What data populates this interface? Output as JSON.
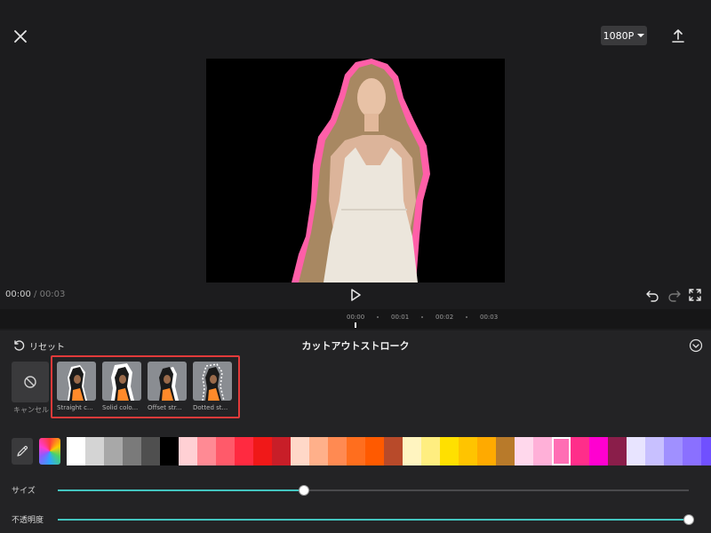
{
  "header": {
    "resolution_label": "1080P"
  },
  "playback": {
    "current_time": "00:00",
    "separator": "/",
    "duration": "00:03"
  },
  "timeline": {
    "ticks": [
      "00:00",
      "00:01",
      "00:02",
      "00:03"
    ]
  },
  "panel": {
    "reset_label": "リセット",
    "title": "カットアウトストローク",
    "cancel_label": "キャンセル",
    "presets": [
      {
        "label": "Straight c..."
      },
      {
        "label": "Solid colo..."
      },
      {
        "label": "Offset str..."
      },
      {
        "label": "Dotted st..."
      }
    ],
    "swatches": [
      "#ffffff",
      "#d4d4d4",
      "#a8a8a8",
      "#7a7a7a",
      "#4f4f4f",
      "#000000",
      "#ffd0d4",
      "#ff8a94",
      "#ff5a6a",
      "#ff2a40",
      "#f01818",
      "#c81e28",
      "#ffd8c8",
      "#ffb08a",
      "#ff8a52",
      "#ff6e1e",
      "#ff5a00",
      "#b84a2a",
      "#fff4c0",
      "#ffee80",
      "#ffe000",
      "#ffc400",
      "#ffaa00",
      "#b87a2a",
      "#ffd8ec",
      "#ffb0d8",
      "#ff6eb4",
      "#ff2e8a",
      "#ff00d0",
      "#8a1e4a",
      "#e8e4ff",
      "#c8c0ff",
      "#a090ff",
      "#8a70ff",
      "#7050ff",
      "#5a3ed0"
    ],
    "selected_swatch": "#ff6eb4",
    "size": {
      "label": "サイズ",
      "value": 0.39
    },
    "opacity": {
      "label": "不透明度",
      "value": 1.0
    }
  },
  "icons": {
    "close": "close-icon",
    "export": "upload-icon",
    "play": "play-icon",
    "undo": "undo-icon",
    "redo": "redo-icon",
    "fullscreen": "fullscreen-icon",
    "reset": "reset-icon",
    "collapse": "chevron-down-icon",
    "cancel": "prohibited-icon",
    "eyedropper": "eyedropper-icon"
  },
  "colors": {
    "stroke": "#ff5fa8",
    "accent": "#43c5c0",
    "highlight_border": "#e23a3a"
  }
}
